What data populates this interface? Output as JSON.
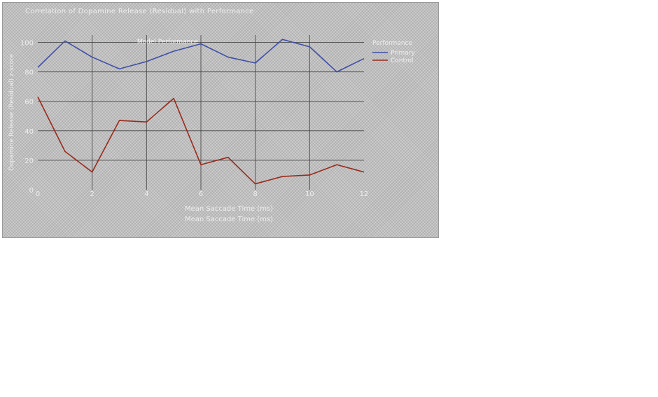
{
  "window": {
    "title": "Correlation of Dopamine Release (Residual) with Performance"
  },
  "chart_data": {
    "type": "line",
    "title": "Correlation of Dopamine Release (Residual) with Performance",
    "annotation": "Model Performance",
    "xlabel": "Mean Saccade Time (ms)",
    "xlabel2": "Mean Saccade Time (ms)",
    "ylabel": "Dopamine Release (Residual) z-score",
    "x_ticks": [
      "0",
      "2",
      "4",
      "6",
      "8",
      "10",
      "12"
    ],
    "y_ticks": [
      "0",
      "20",
      "40",
      "60",
      "80",
      "100"
    ],
    "xlim": [
      0,
      12
    ],
    "ylim": [
      0,
      105
    ],
    "legend_title": "Performance",
    "legend_position": "top-right",
    "grid": true,
    "colors": {
      "primary": "#3f4fa8",
      "secondary": "#9a2a1c",
      "grid": "#333333",
      "text": "#eeeeee"
    },
    "x": [
      0,
      1,
      2,
      3,
      4,
      5,
      6,
      7,
      8,
      9,
      10,
      11,
      12
    ],
    "series": [
      {
        "name": "Primary",
        "color": "#3f4fa8",
        "values": [
          83,
          101,
          90,
          82,
          87,
          94,
          99,
          90,
          86,
          102,
          97,
          80,
          89
        ]
      },
      {
        "name": "Control",
        "color": "#9a2a1c",
        "values": [
          63,
          26,
          12,
          47,
          46,
          62,
          17,
          22,
          4,
          9,
          10,
          17,
          12
        ]
      }
    ]
  }
}
